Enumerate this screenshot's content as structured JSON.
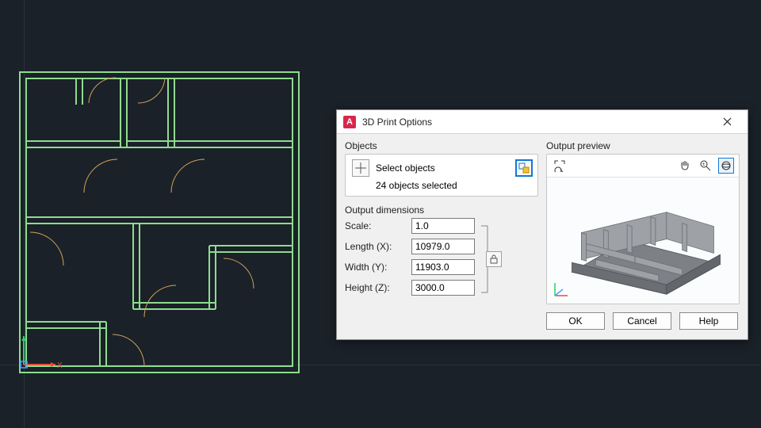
{
  "dialog": {
    "title": "3D Print Options",
    "objects": {
      "section_label": "Objects",
      "select_label": "Select objects",
      "selected_status": "24 objects selected"
    },
    "dimensions": {
      "section_label": "Output dimensions",
      "scale_label": "Scale:",
      "scale_value": "1.0",
      "length_label": "Length (X):",
      "length_value": "10979.0",
      "width_label": "Width (Y):",
      "width_value": "11903.0",
      "height_label": "Height (Z):",
      "height_value": "3000.0"
    },
    "preview": {
      "section_label": "Output preview"
    },
    "buttons": {
      "ok": "OK",
      "cancel": "Cancel",
      "help": "Help"
    }
  }
}
